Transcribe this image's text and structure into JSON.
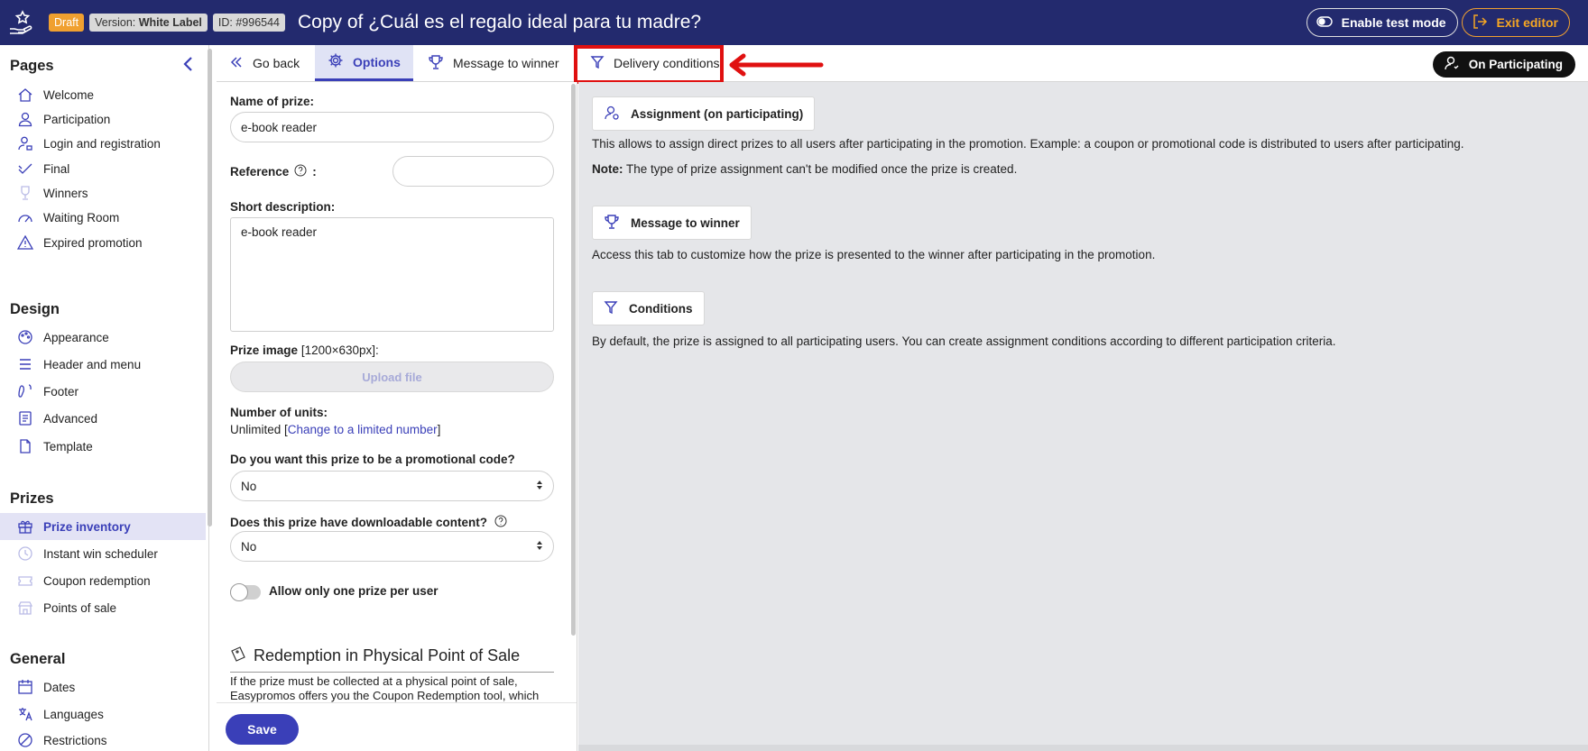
{
  "topbar": {
    "status_badge": "Draft",
    "version_prefix": "Version: ",
    "version_value": "White Label",
    "id_badge": "ID: #996544",
    "title": "Copy of ¿Cuál es el regalo ideal para tu madre?",
    "test_mode_label": "Enable test mode",
    "exit_label": "Exit editor"
  },
  "sidebar": {
    "sections": {
      "pages": "Pages",
      "design": "Design",
      "prizes": "Prizes",
      "general": "General"
    },
    "pages": [
      "Welcome",
      "Participation",
      "Login and registration",
      "Final",
      "Winners",
      "Waiting Room",
      "Expired promotion"
    ],
    "design": [
      "Appearance",
      "Header and menu",
      "Footer",
      "Advanced",
      "Template"
    ],
    "prizes": [
      "Prize inventory",
      "Instant win scheduler",
      "Coupon redemption",
      "Points of sale"
    ],
    "general": [
      "Dates",
      "Languages",
      "Restrictions"
    ]
  },
  "tabs": {
    "go_back": "Go back",
    "options": "Options",
    "message_to_winner": "Message to winner",
    "delivery_conditions": "Delivery conditions",
    "on_participating": "On Participating"
  },
  "form": {
    "name_label": "Name of prize:",
    "name_value": "e-book reader",
    "reference_label": "Reference",
    "reference_suffix": ":",
    "reference_value": "",
    "short_desc_label": "Short description:",
    "short_desc_value": "e-book reader",
    "prize_image_label": "Prize image",
    "prize_image_hint": "[1200×630px]:",
    "upload_label": "Upload file",
    "units_label": "Number of units:",
    "units_value": "Unlimited [",
    "units_link": "Change to a limited number",
    "units_close": "]",
    "promo_label": "Do you want this prize to be a promotional code?",
    "promo_value": "No",
    "download_label": "Does this prize have downloadable content?",
    "download_value": "No",
    "one_prize_label": "Allow only one prize per user",
    "redeem_title": "Redemption in Physical Point of Sale",
    "redeem_text": "If the prize must be collected at a physical point of sale, Easypromos offers you the Coupon Redemption tool, which",
    "save_label": "Save"
  },
  "content": {
    "assignment_btn": "Assignment (on participating)",
    "assignment_text": "This allows to assign direct prizes to all users after participating in the promotion. Example: a coupon or promotional code is distributed to users after participating.",
    "note_label": "Note:",
    "note_text": " The type of prize assignment can't be modified once the prize is created.",
    "message_btn": "Message to winner",
    "message_text": "Access this tab to customize how the prize is presented to the winner after participating in the promotion.",
    "conditions_btn": "Conditions",
    "conditions_text": "By default, the prize is assigned to all participating users. You can create assignment conditions according to different participation criteria."
  },
  "colors": {
    "topbar": "#232a6e",
    "accent": "#3a3fb8",
    "draft": "#f0a030",
    "highlight": "#e01010"
  }
}
